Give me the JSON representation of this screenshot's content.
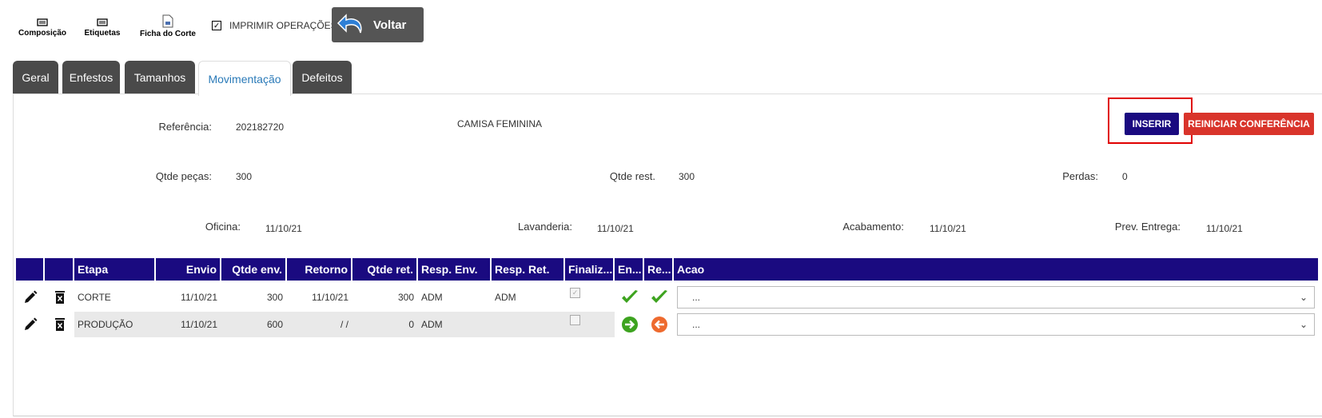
{
  "toolbar": {
    "composicao": "Composição",
    "etiquetas": "Etiquetas",
    "ficha_corte": "Ficha do Corte",
    "imprimir": "IMPRIMIR OPERAÇÕES",
    "voltar": "Voltar"
  },
  "tabs": [
    "Geral",
    "Enfestos",
    "Tamanhos",
    "Movimentação",
    "Defeitos"
  ],
  "active_tab": "Movimentação",
  "form": {
    "referencia_label": "Referência:",
    "referencia": "202182720",
    "descricao": "CAMISA FEMININA",
    "qtde_pecas_label": "Qtde peças:",
    "qtde_pecas": "300",
    "qtde_rest_label": "Qtde rest.",
    "qtde_rest": "300",
    "perdas_label": "Perdas:",
    "perdas": "0",
    "oficina_label": "Oficina:",
    "oficina": "11/10/21",
    "lavanderia_label": "Lavanderia:",
    "lavanderia": "11/10/21",
    "acabamento_label": "Acabamento:",
    "acabamento": "11/10/21",
    "prev_entrega_label": "Prev. Entrega:",
    "prev_entrega": "11/10/21"
  },
  "buttons": {
    "inserir": "INSERIR",
    "reiniciar": "REINICIAR CONFERÊNCIA"
  },
  "table": {
    "headers": [
      "",
      "",
      "Etapa",
      "Envio",
      "Qtde env.",
      "Retorno",
      "Qtde ret.",
      "Resp. Env.",
      "Resp. Ret.",
      "Finaliz...",
      "En...",
      "Re...",
      "Acao"
    ],
    "rows": [
      {
        "etapa": "CORTE",
        "envio": "11/10/21",
        "qtde_env": "300",
        "retorno": "11/10/21",
        "qtde_ret": "300",
        "resp_env": "ADM",
        "resp_ret": "ADM",
        "finalizado": true,
        "acao": "..."
      },
      {
        "etapa": "PRODUÇÃO",
        "envio": "11/10/21",
        "qtde_env": "600",
        "retorno": "/ /",
        "qtde_ret": "0",
        "resp_env": "ADM",
        "resp_ret": "",
        "finalizado": false,
        "acao": "..."
      }
    ]
  },
  "colors": {
    "header": "#1a0a80",
    "inserir": "#1a0a80",
    "reiniciar": "#d9342b",
    "tab_dark": "#4a4a4a",
    "highlight": "#e00000"
  }
}
